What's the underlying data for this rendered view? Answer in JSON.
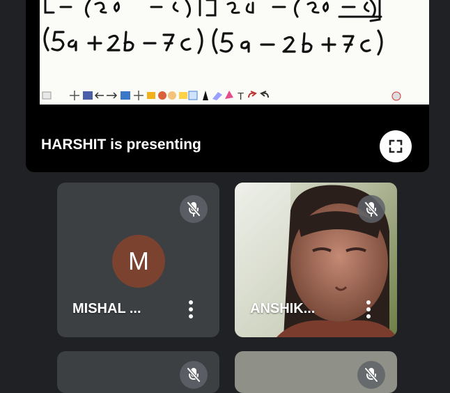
{
  "presentation": {
    "presenting_label": "HARSHIT is presenting",
    "fullscreen_icon": "fullscreen-icon",
    "whiteboard_expression": "(5a + 2b − 7c) (5a − 2b + 7c)"
  },
  "participants": [
    {
      "name": "MISHAL ...",
      "avatar_initial": "M",
      "avatar_color": "#7b4230",
      "muted": true
    },
    {
      "name": "ANSHIK...",
      "muted": true,
      "has_video": true
    }
  ],
  "colors": {
    "background": "#202124",
    "tile": "#3c4043",
    "badge": "#5f6368"
  }
}
